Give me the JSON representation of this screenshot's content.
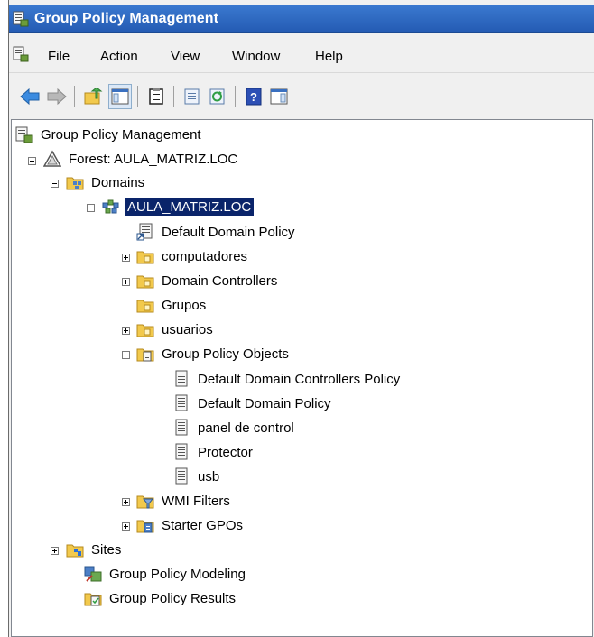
{
  "window": {
    "title": "Group Policy Management"
  },
  "menu": {
    "items": [
      "File",
      "Action",
      "View",
      "Window",
      "Help"
    ]
  },
  "toolbar": {
    "buttons": [
      "back-arrow-icon",
      "forward-arrow-icon",
      "up-folder-icon",
      "show-tree-icon",
      "properties-icon",
      "export-list-icon",
      "refresh-icon",
      "help-icon",
      "action-pane-icon"
    ]
  },
  "tree": {
    "root": "Group Policy Management",
    "forest": "Forest: AULA_MATRIZ.LOC",
    "domains": "Domains",
    "domain": "AULA_MATRIZ.LOC",
    "default_policy_link": "Default Domain Policy",
    "ou_computadores": "computadores",
    "ou_domain_controllers": "Domain Controllers",
    "ou_grupos": "Grupos",
    "ou_usuarios": "usuarios",
    "gpo_container": "Group Policy Objects",
    "gpos": [
      "Default Domain Controllers Policy",
      "Default Domain Policy",
      "panel de control",
      "Protector",
      "usb"
    ],
    "wmi_filters": "WMI Filters",
    "starter_gpos": "Starter GPOs",
    "sites": "Sites",
    "modeling": "Group Policy Modeling",
    "results": "Group Policy Results"
  },
  "colors": {
    "titlebar": "#2d67c4",
    "selection": "#0a246a",
    "folder": "#f2c94c"
  }
}
